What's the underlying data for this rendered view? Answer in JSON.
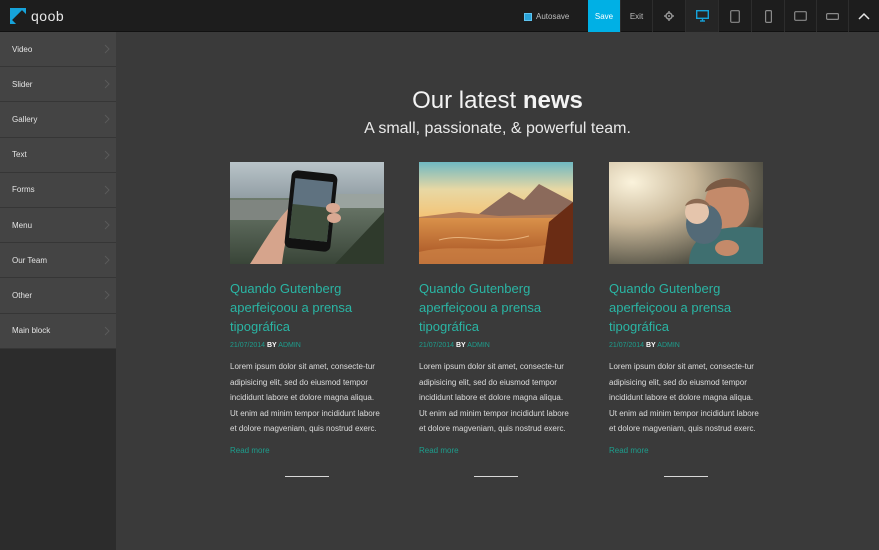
{
  "app": {
    "logo_text": "qoob"
  },
  "toolbar": {
    "autosave_label": "Autosave",
    "save_label": "Save",
    "exit_label": "Exit",
    "icons": [
      "gear-icon",
      "desktop-icon",
      "tablet-icon",
      "phone-icon",
      "tablet-landscape-icon",
      "phone-landscape-icon",
      "chevron-up-icon"
    ],
    "active_device": "desktop",
    "accent": "#00b0e5"
  },
  "sidebar": {
    "items": [
      {
        "label": "Video"
      },
      {
        "label": "Slider"
      },
      {
        "label": "Gallery"
      },
      {
        "label": "Text"
      },
      {
        "label": "Forms"
      },
      {
        "label": "Menu"
      },
      {
        "label": "Our Team"
      },
      {
        "label": "Other"
      },
      {
        "label": "Main block"
      }
    ]
  },
  "main": {
    "heading_light": "Our latest ",
    "heading_bold": "news",
    "subheading": "A small, passionate, & powerful team.",
    "title_color": "#2ab5a4",
    "cards": [
      {
        "title": "Quando Gutenberg aperfeiçoou a prensa tipográfica",
        "date": "21/07/2014",
        "by": "BY",
        "author": "ADMIN",
        "text": "Lorem ipsum dolor sit amet, consecte-tur adipisicing elit, sed do eiusmod tempor incididunt labore et dolore magna aliqua. Ut enim ad minim tempor incididunt labore et dolore magveniam, quis nostrud exerc.",
        "read_more": "Read more",
        "image": "phone-photo"
      },
      {
        "title": "Quando Gutenberg aperfeiçoou a prensa tipográfica",
        "date": "21/07/2014",
        "by": "BY",
        "author": "ADMIN",
        "text": "Lorem ipsum dolor sit amet, consecte-tur adipisicing elit, sed do eiusmod tempor incididunt labore et dolore magna aliqua. Ut enim ad minim tempor incididunt labore et dolore magveniam, quis nostrud exerc.",
        "read_more": "Read more",
        "image": "desert-photo"
      },
      {
        "title": "Quando Gutenberg aperfeiçoou a prensa tipográfica",
        "date": "21/07/2014",
        "by": "BY",
        "author": "ADMIN",
        "text": "Lorem ipsum dolor sit amet, consecte-tur adipisicing elit, sed do eiusmod tempor incididunt labore et dolore magna aliqua. Ut enim ad minim tempor incididunt labore et dolore magveniam, quis nostrud exerc.",
        "read_more": "Read more",
        "image": "father-child-photo"
      }
    ]
  }
}
